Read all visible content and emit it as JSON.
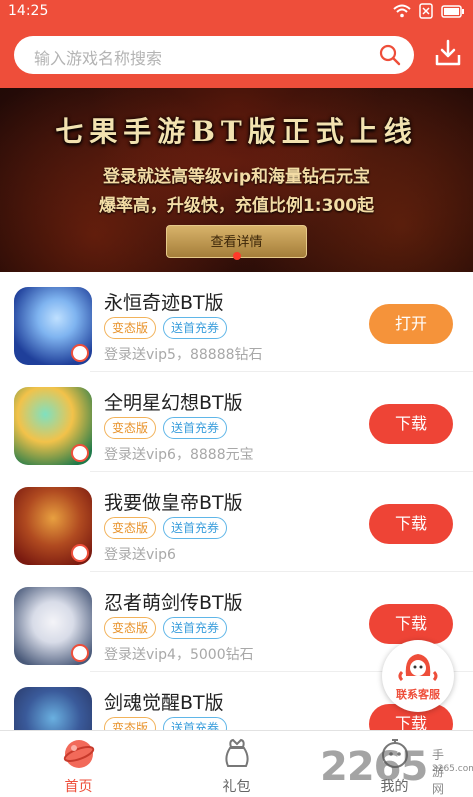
{
  "status_bar": {
    "time": "14:25"
  },
  "header": {
    "search_placeholder": "输入游戏名称搜索"
  },
  "banner": {
    "title": "七果手游BT版正式上线",
    "line1": "登录就送高等级vip和海量钻石元宝",
    "line2": "爆率高，升级快，充值比例1:300起",
    "button_label": "查看详情"
  },
  "games": [
    {
      "name": "永恒奇迹BT版",
      "tags": [
        "变态版",
        "送首充券"
      ],
      "desc": "登录送vip5，88888钻石",
      "action": "打开",
      "action_type": "open",
      "colors": [
        "#1f3f9a",
        "#7fb4f0"
      ]
    },
    {
      "name": "全明星幻想BT版",
      "tags": [
        "变态版",
        "送首充券"
      ],
      "desc": "登录送vip6，8888元宝",
      "action": "下载",
      "action_type": "download",
      "colors": [
        "#1f7a4a",
        "#f2c24a"
      ]
    },
    {
      "name": "我要做皇帝BT版",
      "tags": [
        "变态版",
        "送首充券"
      ],
      "desc": "登录送vip6",
      "action": "下载",
      "action_type": "download",
      "colors": [
        "#7a1a10",
        "#e8a040"
      ]
    },
    {
      "name": "忍者萌剑传BT版",
      "tags": [
        "变态版",
        "送首充券"
      ],
      "desc": "登录送vip4，5000钻石",
      "action": "下载",
      "action_type": "download",
      "colors": [
        "#4a5a7a",
        "#d8dce8"
      ]
    },
    {
      "name": "剑魂觉醒BT版",
      "tags": [
        "变态版",
        "送首充券"
      ],
      "desc": "",
      "action": "下载",
      "action_type": "download",
      "colors": [
        "#2a3a6a",
        "#6ab0e0"
      ]
    }
  ],
  "service": {
    "label": "联系客服"
  },
  "tabs": [
    {
      "label": "首页",
      "icon": "home-icon",
      "active": true
    },
    {
      "label": "礼包",
      "icon": "gift-bag-icon",
      "active": false
    },
    {
      "label": "我的",
      "icon": "profile-icon",
      "active": false
    }
  ],
  "watermark": {
    "number": "2265",
    "site": "手游网",
    "url": "2265.com"
  },
  "colors": {
    "accent": "#ee4e3a",
    "open_button": "#f5933a",
    "download_button": "#ee4436"
  }
}
